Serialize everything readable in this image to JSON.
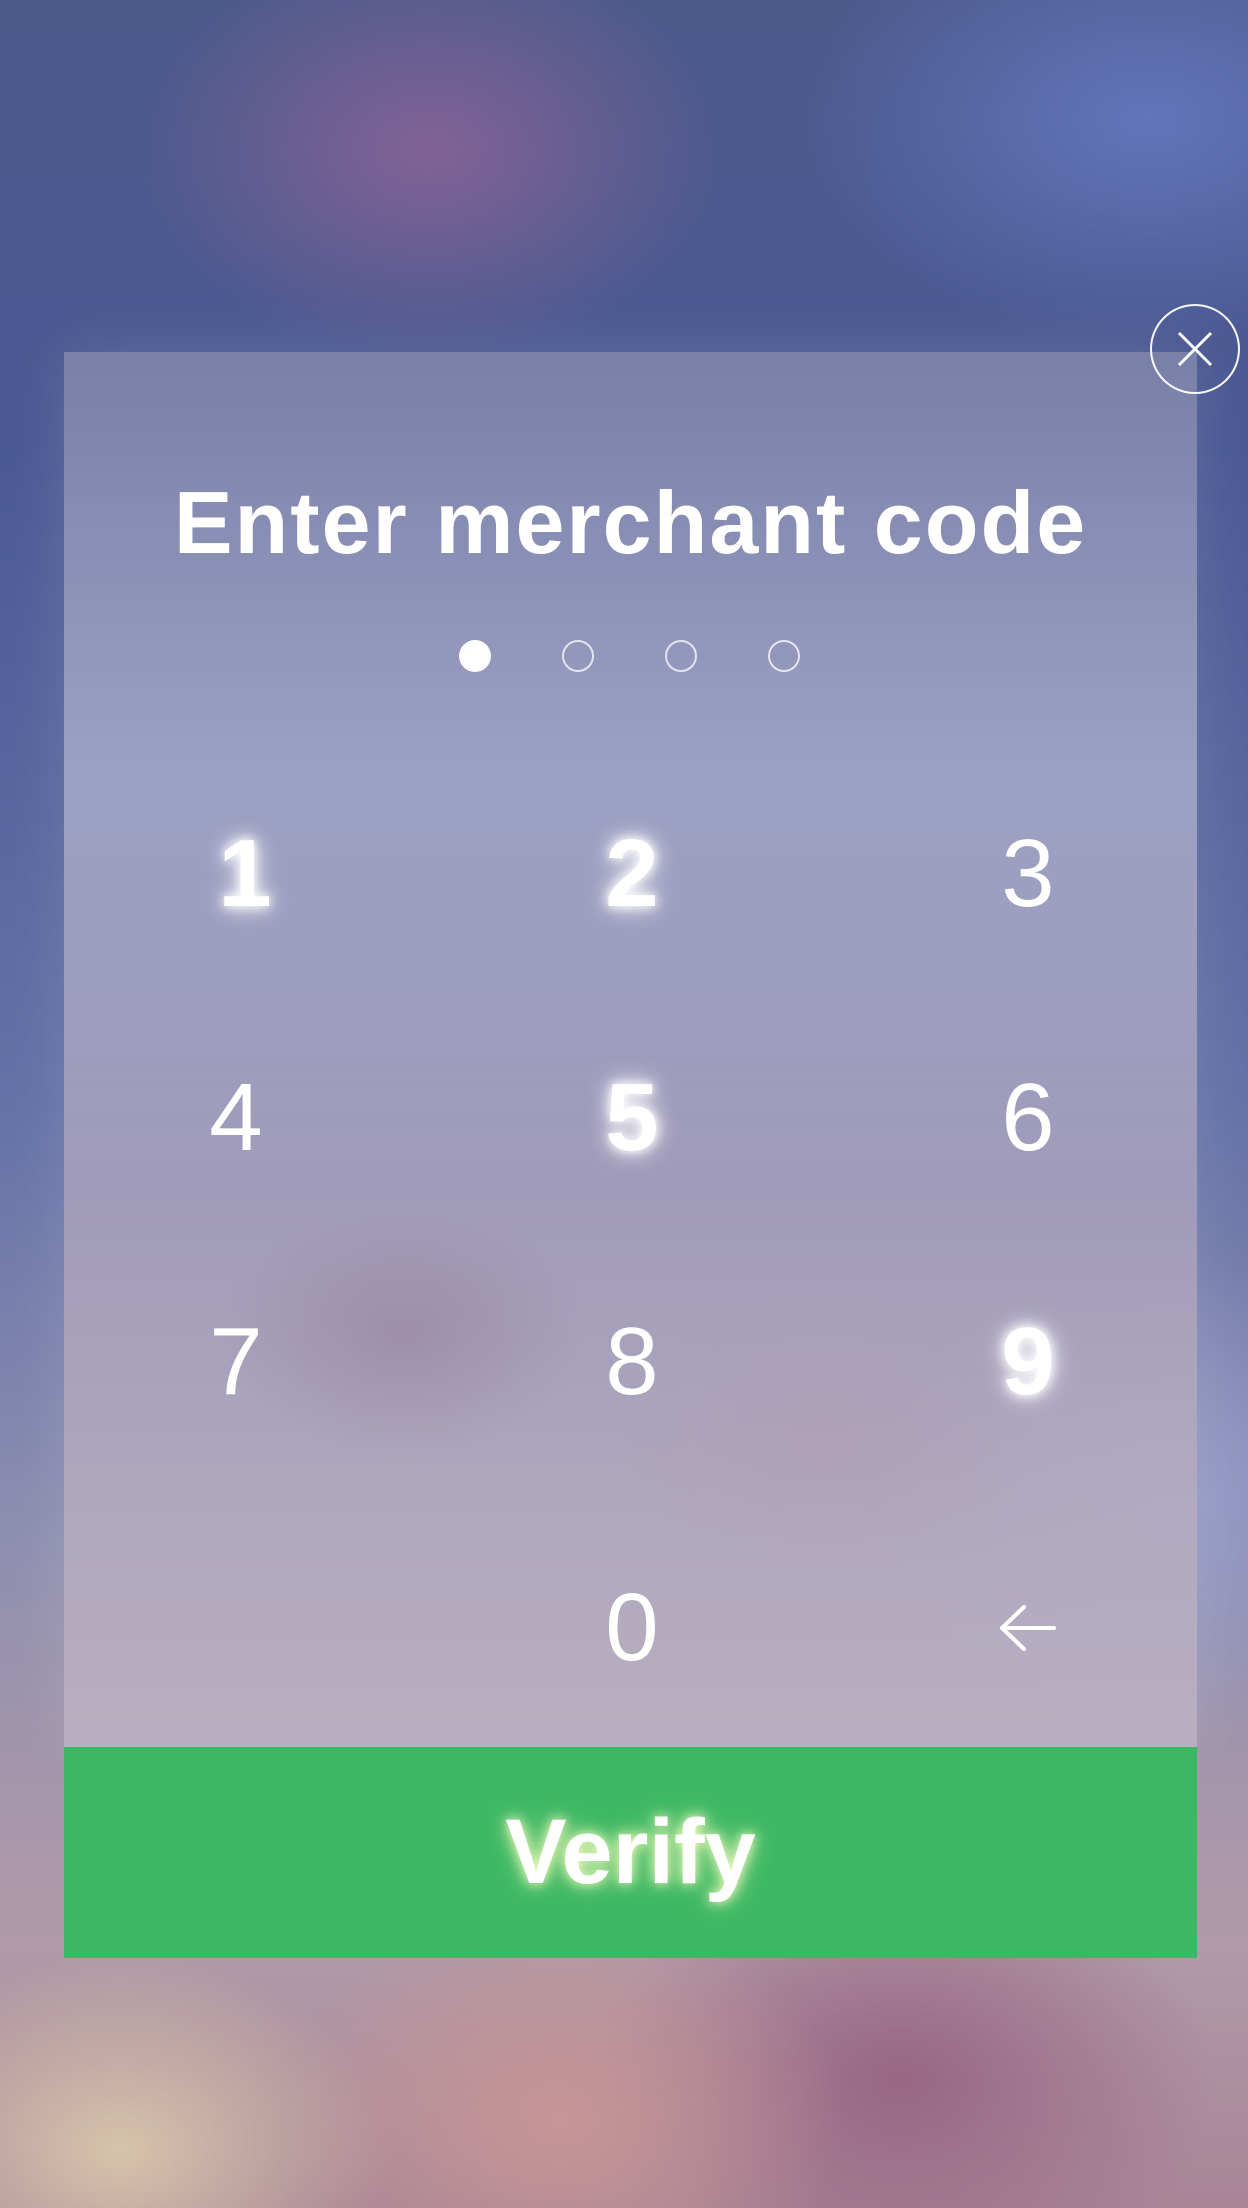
{
  "dialog": {
    "title": "Enter merchant code",
    "close_icon": "close-x-icon",
    "verify_label": "Verify",
    "verify_color": "#3cb864"
  },
  "code_indicator": {
    "length": 4,
    "filled": 1
  },
  "keypad": {
    "keys": [
      "1",
      "2",
      "3",
      "4",
      "5",
      "6",
      "7",
      "8",
      "9",
      "0"
    ],
    "highlighted_keys": [
      "1",
      "2",
      "5",
      "9"
    ],
    "backspace_icon": "backspace-arrow-icon"
  }
}
